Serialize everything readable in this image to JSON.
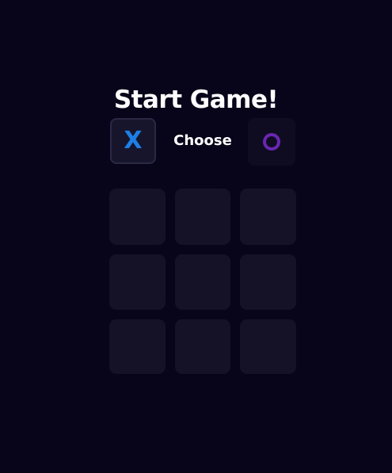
{
  "title": "Start Game!",
  "chooser": {
    "label": "Choose",
    "options": [
      {
        "mark": "X",
        "selected": true,
        "color": "#1d7fe6"
      },
      {
        "mark": "O",
        "selected": false,
        "color": "#6a26b2"
      }
    ]
  },
  "board": {
    "cells": [
      "",
      "",
      "",
      "",
      "",
      "",
      "",
      "",
      ""
    ]
  },
  "colors": {
    "background": "#08051a",
    "cell": "#151227",
    "x": "#1d7fe6",
    "o": "#6a26b2"
  }
}
